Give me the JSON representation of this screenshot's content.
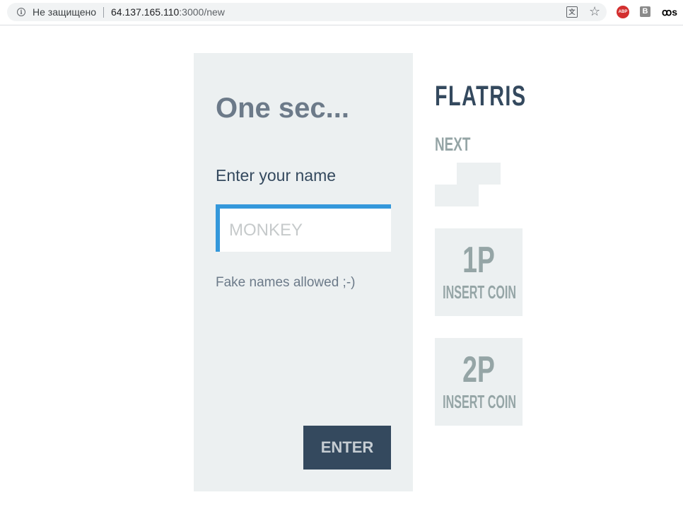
{
  "browser": {
    "security_text": "Не защищено",
    "url_host": "64.137.165.110",
    "url_rest": ":3000/new",
    "icons": [
      "info-icon",
      "translate-icon",
      "star-icon",
      "adblock-plus-icon",
      "b-extension-icon",
      "os-extension-icon"
    ],
    "abp_label": "ABP",
    "b_label": "B",
    "os_label": "ꝏs"
  },
  "form": {
    "headline": "One sec...",
    "prompt": "Enter your name",
    "name_value": "",
    "name_placeholder": "MONKEY",
    "hint": "Fake names allowed ;-)",
    "enter_label": "ENTER"
  },
  "sidebar": {
    "title": "FLATRIS",
    "next_label": "NEXT",
    "next_piece": "S",
    "players": [
      {
        "label": "1P",
        "status": "INSERT COIN"
      },
      {
        "label": "2P",
        "status": "INSERT COIN"
      }
    ]
  },
  "colors": {
    "panel_bg": "#ecf0f1",
    "accent": "#3498db",
    "dark": "#34495e",
    "muted": "#95a5a6"
  }
}
